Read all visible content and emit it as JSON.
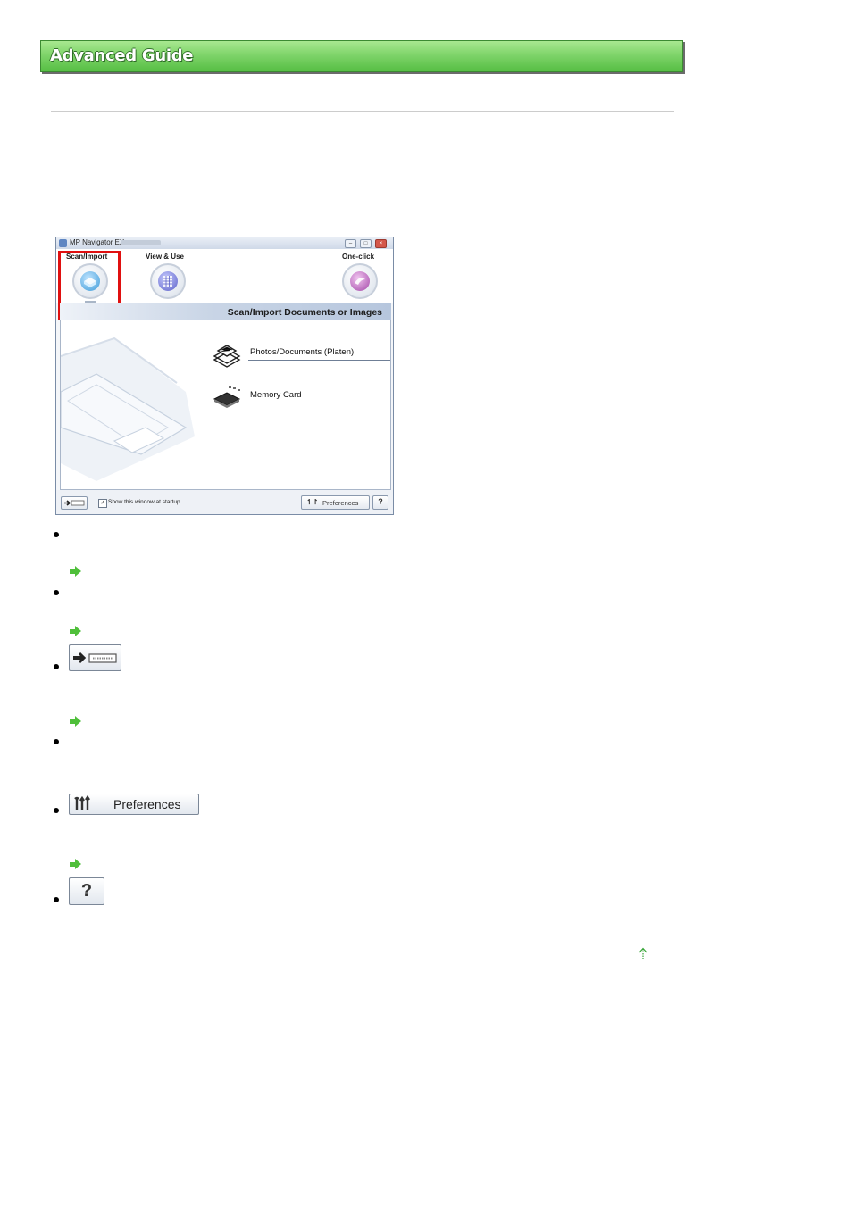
{
  "banner": {
    "title": "Advanced Guide"
  },
  "window": {
    "title": "MP Navigator EX",
    "tabs": [
      {
        "label": "Scan/Import",
        "icon": "scan-import-icon"
      },
      {
        "label": "View & Use",
        "icon": "view-use-icon"
      },
      {
        "label": "One-click",
        "icon": "one-click-icon"
      }
    ],
    "header": "Scan/Import Documents or Images",
    "options": [
      {
        "label": "Photos/Documents (Platen)",
        "icon": "photos-documents-icon"
      },
      {
        "label": "Memory Card",
        "icon": "memory-card-icon"
      }
    ],
    "bottom": {
      "startup_checkbox": "Show this window at startup",
      "startup_checked": true,
      "preferences": "Preferences",
      "help": "?"
    }
  },
  "list_buttons": {
    "preferences": "Preferences",
    "help": "?"
  },
  "colors": {
    "banner_green": "#6acc56",
    "highlight": "#e01010",
    "link_arrow": "#4fbf3a"
  }
}
